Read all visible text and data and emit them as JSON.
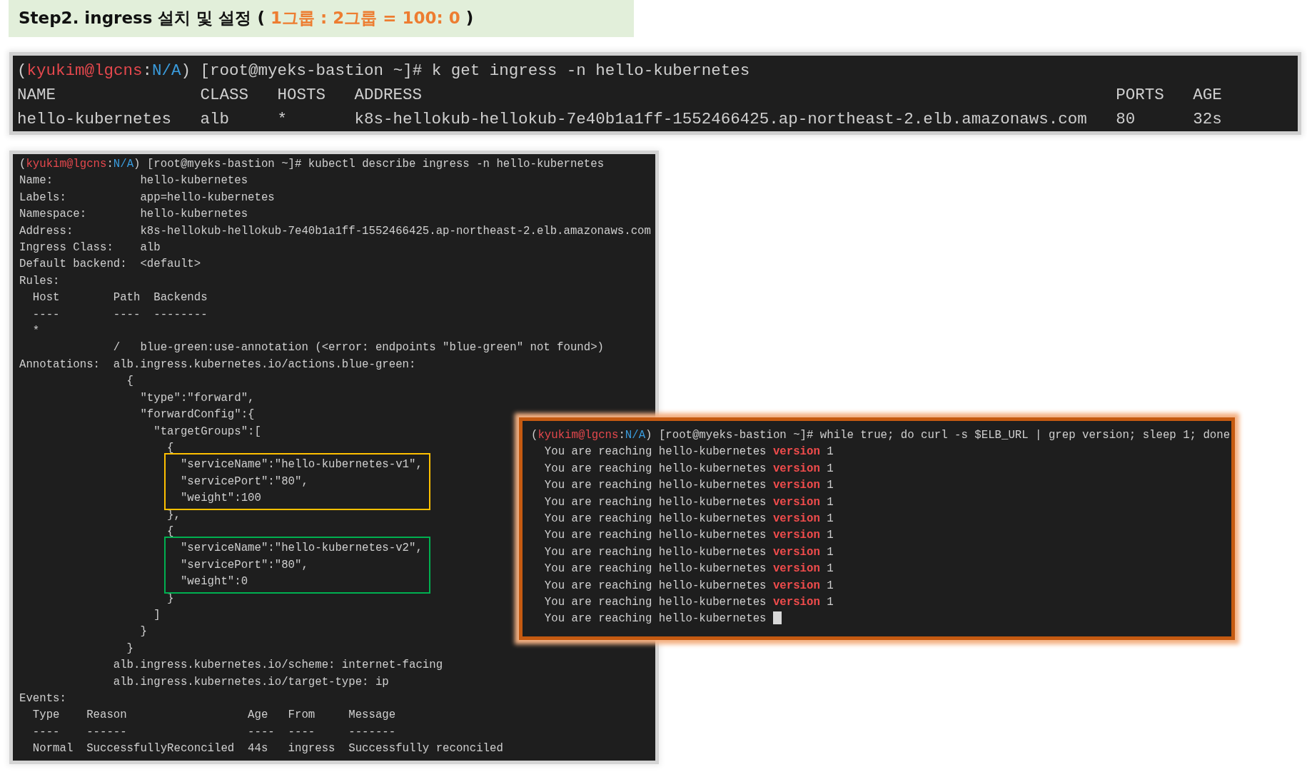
{
  "title": {
    "parts": [
      {
        "text": "Step2. ingress 설치 및 설정 ( ",
        "accent": false
      },
      {
        "text": "1그룹 : 2그룹 = 100: 0",
        "accent": true
      },
      {
        "text": " )",
        "accent": false
      }
    ]
  },
  "terminals": [
    {
      "kind": "large",
      "lines": [
        {
          "segments": [
            {
              "text": "(",
              "kind": "plain"
            },
            {
              "text": "kyukim@lgcns",
              "kind": "user"
            },
            {
              "text": ":",
              "kind": "plain"
            },
            {
              "text": "N/A",
              "kind": "env"
            },
            {
              "text": ") [root@myeks-bastion ~]# k get ingress -n hello-kubernetes",
              "kind": "plain"
            }
          ]
        },
        {
          "text": "NAME               CLASS   HOSTS   ADDRESS                                                                        PORTS   AGE"
        },
        {
          "text": "hello-kubernetes   alb     *       k8s-hellokub-hellokub-7e40b1a1ff-1552466425.ap-northeast-2.elb.amazonaws.com   80      32s"
        }
      ]
    },
    {
      "kind": "small",
      "lines": [
        {
          "segments": [
            {
              "text": "(",
              "kind": "plain"
            },
            {
              "text": "kyukim@lgcns",
              "kind": "user"
            },
            {
              "text": ":",
              "kind": "plain"
            },
            {
              "text": "N/A",
              "kind": "env"
            },
            {
              "text": ") [root@myeks-bastion ~]# kubectl describe ingress -n hello-kubernetes",
              "kind": "plain"
            }
          ]
        },
        {
          "text": "Name:             hello-kubernetes"
        },
        {
          "text": "Labels:           app=hello-kubernetes"
        },
        {
          "text": "Namespace:        hello-kubernetes"
        },
        {
          "text": "Address:          k8s-hellokub-hellokub-7e40b1a1ff-1552466425.ap-northeast-2.elb.amazonaws.com"
        },
        {
          "text": "Ingress Class:    alb"
        },
        {
          "text": "Default backend:  <default>"
        },
        {
          "text": "Rules:"
        },
        {
          "text": "  Host        Path  Backends"
        },
        {
          "text": "  ----        ----  --------"
        },
        {
          "text": "  *"
        },
        {
          "text": "              /   blue-green:use-annotation (<error: endpoints \"blue-green\" not found>)"
        },
        {
          "text": "Annotations:  alb.ingress.kubernetes.io/actions.blue-green:"
        },
        {
          "text": "                {"
        },
        {
          "text": "                  \"type\":\"forward\","
        },
        {
          "text": "                  \"forwardConfig\":{"
        },
        {
          "text": "                    \"targetGroups\":["
        },
        {
          "text": "                      {"
        },
        {
          "kind": "group",
          "color": "#ffc000",
          "lines": [
            {
              "text": "                        \"serviceName\":\"hello-kubernetes-v1\","
            },
            {
              "text": "                        \"servicePort\":\"80\","
            },
            {
              "text": "                        \"weight\":100"
            }
          ]
        },
        {
          "text": "                      },"
        },
        {
          "text": "                      {"
        },
        {
          "kind": "group",
          "color": "#00b050",
          "lines": [
            {
              "text": "                        \"serviceName\":\"hello-kubernetes-v2\","
            },
            {
              "text": "                        \"servicePort\":\"80\","
            },
            {
              "text": "                        \"weight\":0"
            }
          ]
        },
        {
          "text": "                      }"
        },
        {
          "text": "                    ]"
        },
        {
          "text": "                  }"
        },
        {
          "text": "                }"
        },
        {
          "text": "              alb.ingress.kubernetes.io/scheme: internet-facing"
        },
        {
          "text": "              alb.ingress.kubernetes.io/target-type: ip"
        },
        {
          "text": "Events:"
        },
        {
          "text": "  Type    Reason                  Age   From     Message"
        },
        {
          "text": "  ----    ------                  ----  ----     -------"
        },
        {
          "text": "  Normal  SuccessfullyReconciled  44s   ingress  Successfully reconciled"
        }
      ]
    },
    {
      "kind": "loop",
      "lines": [
        {
          "segments": [
            {
              "text": "(",
              "kind": "plain"
            },
            {
              "text": "kyukim@lgcns",
              "kind": "user"
            },
            {
              "text": ":",
              "kind": "plain"
            },
            {
              "text": "N/A",
              "kind": "env"
            },
            {
              "text": ") [root@myeks-bastion ~]# while true; do curl -s $ELB_URL | grep version; sleep 1; done",
              "kind": "plain"
            }
          ]
        },
        {
          "segments": [
            {
              "text": "  You are reaching hello-kubernetes ",
              "kind": "plain"
            },
            {
              "text": "version",
              "kind": "red"
            },
            {
              "text": " 1",
              "kind": "plain"
            }
          ]
        },
        {
          "segments": [
            {
              "text": "  You are reaching hello-kubernetes ",
              "kind": "plain"
            },
            {
              "text": "version",
              "kind": "red"
            },
            {
              "text": " 1",
              "kind": "plain"
            }
          ]
        },
        {
          "segments": [
            {
              "text": "  You are reaching hello-kubernetes ",
              "kind": "plain"
            },
            {
              "text": "version",
              "kind": "red"
            },
            {
              "text": " 1",
              "kind": "plain"
            }
          ]
        },
        {
          "segments": [
            {
              "text": "  You are reaching hello-kubernetes ",
              "kind": "plain"
            },
            {
              "text": "version",
              "kind": "red"
            },
            {
              "text": " 1",
              "kind": "plain"
            }
          ]
        },
        {
          "segments": [
            {
              "text": "  You are reaching hello-kubernetes ",
              "kind": "plain"
            },
            {
              "text": "version",
              "kind": "red"
            },
            {
              "text": " 1",
              "kind": "plain"
            }
          ]
        },
        {
          "segments": [
            {
              "text": "  You are reaching hello-kubernetes ",
              "kind": "plain"
            },
            {
              "text": "version",
              "kind": "red"
            },
            {
              "text": " 1",
              "kind": "plain"
            }
          ]
        },
        {
          "segments": [
            {
              "text": "  You are reaching hello-kubernetes ",
              "kind": "plain"
            },
            {
              "text": "version",
              "kind": "red"
            },
            {
              "text": " 1",
              "kind": "plain"
            }
          ]
        },
        {
          "segments": [
            {
              "text": "  You are reaching hello-kubernetes ",
              "kind": "plain"
            },
            {
              "text": "version",
              "kind": "red"
            },
            {
              "text": " 1",
              "kind": "plain"
            }
          ]
        },
        {
          "segments": [
            {
              "text": "  You are reaching hello-kubernetes ",
              "kind": "plain"
            },
            {
              "text": "version",
              "kind": "red"
            },
            {
              "text": " 1",
              "kind": "plain"
            }
          ]
        },
        {
          "segments": [
            {
              "text": "  You are reaching hello-kubernetes ",
              "kind": "plain"
            },
            {
              "text": "version",
              "kind": "red"
            },
            {
              "text": " 1",
              "kind": "plain"
            }
          ]
        },
        {
          "segments": [
            {
              "text": "  You are reaching hello-kubernetes ",
              "kind": "plain"
            },
            {
              "kind": "cursor"
            }
          ]
        }
      ]
    }
  ]
}
